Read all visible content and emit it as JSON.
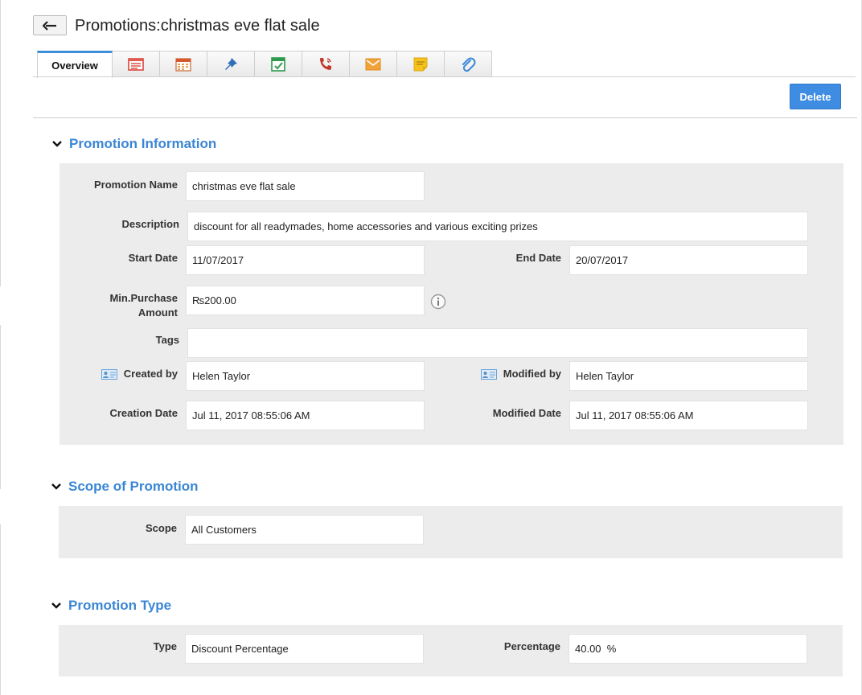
{
  "header": {
    "title": "Promotions:christmas eve flat sale"
  },
  "tabs": [
    {
      "label": "Overview",
      "icon": "overview"
    },
    {
      "label": "",
      "icon": "notes-list-icon"
    },
    {
      "label": "",
      "icon": "calendar-icon"
    },
    {
      "label": "",
      "icon": "pin-icon"
    },
    {
      "label": "",
      "icon": "task-check-icon"
    },
    {
      "label": "",
      "icon": "phone-call-icon"
    },
    {
      "label": "",
      "icon": "email-icon"
    },
    {
      "label": "",
      "icon": "sticky-note-icon"
    },
    {
      "label": "",
      "icon": "attachment-icon"
    }
  ],
  "actions": {
    "delete_label": "Delete"
  },
  "sections": {
    "info": {
      "title": "Promotion Information",
      "fields": {
        "promotion_name": {
          "label": "Promotion Name",
          "value": "christmas eve flat sale"
        },
        "description": {
          "label": "Description",
          "value": "discount for all readymades, home accessories and various exciting prizes"
        },
        "start_date": {
          "label": "Start Date",
          "value": "11/07/2017"
        },
        "end_date": {
          "label": "End Date",
          "value": "20/07/2017"
        },
        "min_purchase_line1": "Min.Purchase",
        "min_purchase_line2": "Amount",
        "min_purchase_value": "₨200.00",
        "tags": {
          "label": "Tags",
          "value": ""
        },
        "created_by": {
          "label": "Created by",
          "value": "Helen Taylor"
        },
        "modified_by": {
          "label": "Modified by",
          "value": "Helen Taylor"
        },
        "creation_date": {
          "label": "Creation Date",
          "value": "Jul 11, 2017 08:55:06 AM"
        },
        "modified_date": {
          "label": "Modified Date",
          "value": "Jul 11, 2017 08:55:06 AM"
        }
      }
    },
    "scope": {
      "title": "Scope of Promotion",
      "fields": {
        "scope": {
          "label": "Scope",
          "value": "All Customers"
        }
      }
    },
    "type": {
      "title": "Promotion Type",
      "fields": {
        "type": {
          "label": "Type",
          "value": "Discount Percentage"
        },
        "percentage": {
          "label": "Percentage",
          "value": "40.00  %"
        }
      }
    }
  },
  "colors": {
    "accent": "#3a86d4",
    "button": "#3e8de2",
    "panel": "#ececec"
  }
}
